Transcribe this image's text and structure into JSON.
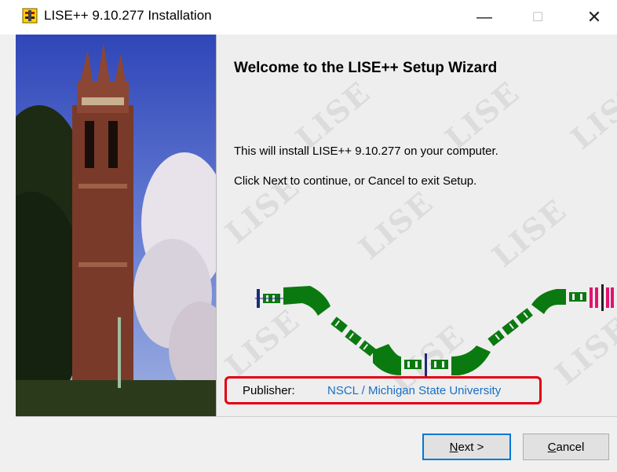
{
  "window": {
    "title": "LISE++ 9.10.277 Installation",
    "controls": {
      "minimize": "—",
      "maximize": "☐",
      "close": "✕"
    }
  },
  "wizard": {
    "heading": "Welcome to the LISE++ Setup Wizard",
    "install_text": "This will install LISE++ 9.10.277 on your computer.",
    "instruction_text": "Click Next to continue, or Cancel to exit Setup.",
    "watermark": "LISE",
    "publisher_label": "Publisher:",
    "publisher_value": "NSCL / Michigan State University"
  },
  "buttons": {
    "next_accel": "N",
    "next_rest": "ext >",
    "cancel_accel": "C",
    "cancel_rest": "ancel"
  },
  "colors": {
    "accent_blue": "#0078d7",
    "highlight_red": "#e2000f",
    "magnet_green": "#0a7a10",
    "link_blue": "#1a6fc4"
  }
}
